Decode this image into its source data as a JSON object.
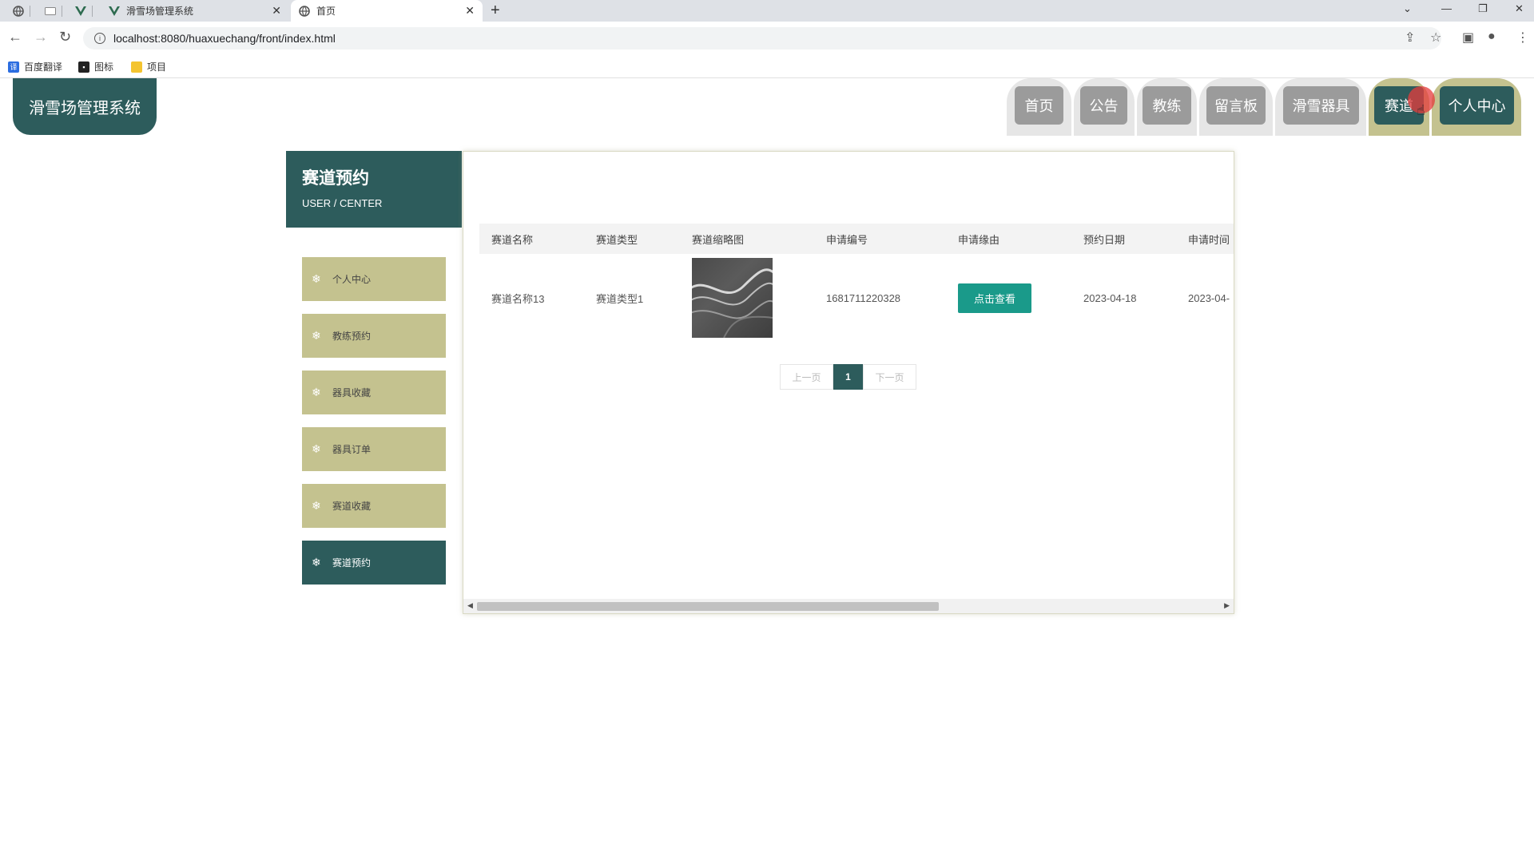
{
  "browser": {
    "tabs": [
      {
        "title": "滑雪场管理系统"
      },
      {
        "title": "首页"
      }
    ],
    "url": "localhost:8080/huaxuechang/front/index.html",
    "bookmarks": [
      "百度翻译",
      "图标",
      "项目"
    ]
  },
  "site": {
    "logo": "滑雪场管理系统",
    "nav": [
      "首页",
      "公告",
      "教练",
      "留言板",
      "滑雪器具",
      "赛道",
      "个人中心"
    ],
    "active_nav": "个人中心"
  },
  "center": {
    "title": "赛道预约",
    "subtitle": "USER / CENTER",
    "menu": [
      "个人中心",
      "教练预约",
      "器具收藏",
      "器具订单",
      "赛道收藏",
      "赛道预约"
    ],
    "active_menu": "赛道预约"
  },
  "table": {
    "headers": [
      "赛道名称",
      "赛道类型",
      "赛道缩略图",
      "申请编号",
      "申请缘由",
      "预约日期",
      "申请时间"
    ],
    "rows": [
      {
        "name": "赛道名称13",
        "type": "赛道类型1",
        "number": "1681711220328",
        "reason_button": "点击查看",
        "date": "2023-04-18",
        "time": "2023-04-"
      }
    ]
  },
  "pager": {
    "prev": "上一页",
    "current": "1",
    "next": "下一页"
  },
  "colors": {
    "primary": "#2d5c5c",
    "accent": "#c4c28f",
    "button": "#1a9a8a",
    "nav_inactive": "#9b9b9b"
  }
}
